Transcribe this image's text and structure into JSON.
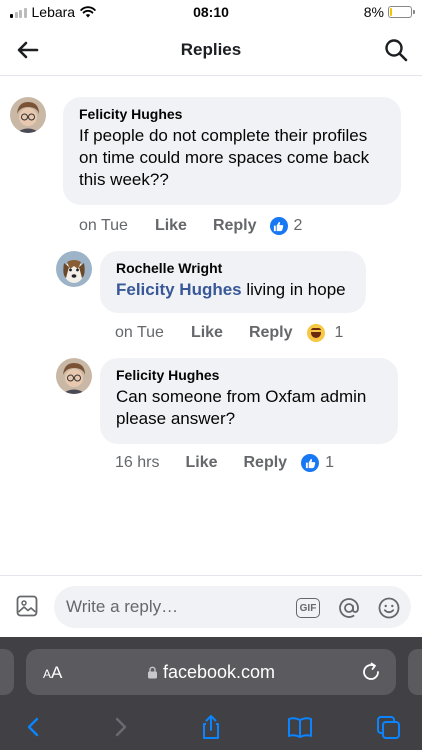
{
  "status": {
    "carrier": "Lebara",
    "time": "08:10",
    "battery": "8%",
    "battery_level": 0.08,
    "battery_color": "#f5c400"
  },
  "header": {
    "title": "Replies",
    "back_icon": "arrow-left-icon",
    "search_icon": "search-icon"
  },
  "comments": [
    {
      "author": "Felicity Hughes",
      "text": "If people do not complete their profiles on time could more spaces come back this week??",
      "time": "on Tue",
      "like_label": "Like",
      "reply_label": "Reply",
      "reaction": "like",
      "reaction_count": "2"
    },
    {
      "author": "Rochelle Wright",
      "mention": "Felicity Hughes",
      "text": " living in hope",
      "time": "on Tue",
      "like_label": "Like",
      "reply_label": "Reply",
      "reaction": "haha",
      "reaction_count": "1"
    },
    {
      "author": "Felicity Hughes",
      "text": "Can someone from Oxfam admin please answer?",
      "time": "16 hrs",
      "like_label": "Like",
      "reply_label": "Reply",
      "reaction": "like",
      "reaction_count": "1"
    }
  ],
  "reply_bar": {
    "placeholder": "Write a reply…",
    "gif_label": "GIF"
  },
  "browser": {
    "aa_small": "A",
    "aa_large": "A",
    "url": "facebook.com"
  },
  "colors": {
    "like_blue": "#1877f2",
    "mention_blue": "#385898",
    "bubble_bg": "#f0f2f5",
    "browser_bg": "#414145",
    "toolbar_icon": "#0a84ff"
  }
}
